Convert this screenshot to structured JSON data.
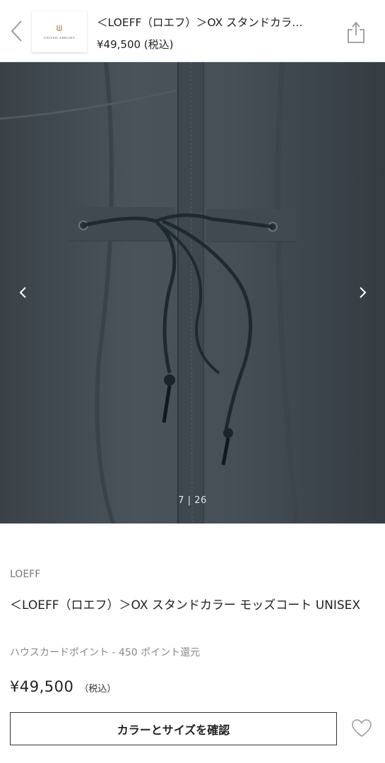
{
  "header": {
    "title": "＜LOEFF（ロエフ）＞OX スタンドカラ…",
    "price": "¥49,500 (税込)",
    "logo_text": "UNITED ARROWS",
    "back_icon": "chevron-left-icon",
    "share_icon": "share-icon"
  },
  "gallery": {
    "current": "7",
    "separator": "|",
    "total": "26",
    "prev_icon": "chevron-left-icon",
    "next_icon": "chevron-right-icon"
  },
  "product": {
    "brand": "LOEFF",
    "name": "＜LOEFF（ロエフ）＞OX スタンドカラー モッズコート UNISEX",
    "points": "ハウスカードポイント - 450 ポイント還元",
    "price": "¥49,500",
    "tax_label": "（税込）"
  },
  "actions": {
    "confirm_label": "カラーとサイズを確認",
    "favorite_icon": "heart-icon"
  },
  "colors": {
    "fabric": "#454e55",
    "cord": "#1e2a30",
    "text": "#222222",
    "muted": "#888888"
  }
}
